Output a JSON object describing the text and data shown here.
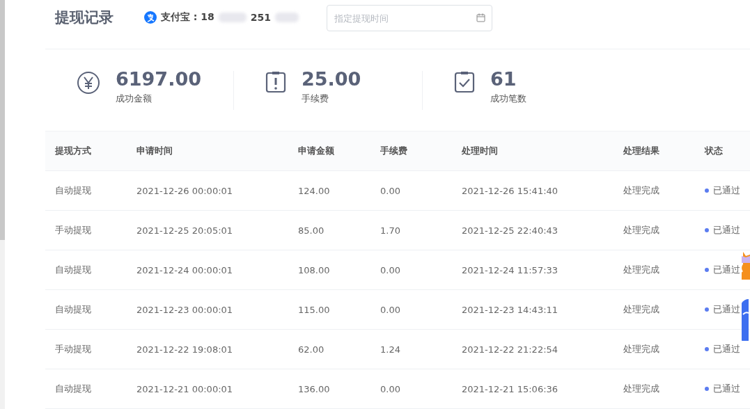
{
  "header": {
    "title": "提现记录",
    "account_label": "支付宝 : 18",
    "account_tail": "251",
    "date_field": {
      "placeholder": "指定提现时间"
    }
  },
  "stats": [
    {
      "kind": "yen",
      "value": "6197.00",
      "label": "成功金额"
    },
    {
      "kind": "alert",
      "value": "25.00",
      "label": "手续费"
    },
    {
      "kind": "check",
      "value": "61",
      "label": "成功笔数"
    }
  ],
  "table": {
    "columns": [
      "提现方式",
      "申请时间",
      "申请金额",
      "手续费",
      "处理时间",
      "处理结果",
      "状态"
    ],
    "rows": [
      {
        "cells": [
          "自动提现",
          "2021-12-26 00:00:01",
          "124.00",
          "0.00",
          "2021-12-26 15:41:40",
          "处理完成"
        ],
        "status": "已通过",
        "color": "#5b7cf0"
      },
      {
        "cells": [
          "手动提现",
          "2021-12-25 20:05:01",
          "85.00",
          "1.70",
          "2021-12-25 22:40:43",
          "处理完成"
        ],
        "status": "已通过",
        "color": "#5b7cf0"
      },
      {
        "cells": [
          "自动提现",
          "2021-12-24 00:00:01",
          "108.00",
          "0.00",
          "2021-12-24 11:57:33",
          "处理完成"
        ],
        "status": "已通过",
        "color": "#5b7cf0"
      },
      {
        "cells": [
          "自动提现",
          "2021-12-23 00:00:01",
          "115.00",
          "0.00",
          "2021-12-23 14:43:11",
          "处理完成"
        ],
        "status": "已通过",
        "color": "#5b7cf0"
      },
      {
        "cells": [
          "手动提现",
          "2021-12-22 19:08:01",
          "62.00",
          "1.24",
          "2021-12-22 21:22:54",
          "处理完成"
        ],
        "status": "已通过",
        "color": "#5b7cf0"
      },
      {
        "cells": [
          "自动提现",
          "2021-12-21 00:00:01",
          "136.00",
          "0.00",
          "2021-12-21 15:06:36",
          "处理完成"
        ],
        "status": "已通过",
        "color": "#5b7cf0"
      }
    ]
  }
}
